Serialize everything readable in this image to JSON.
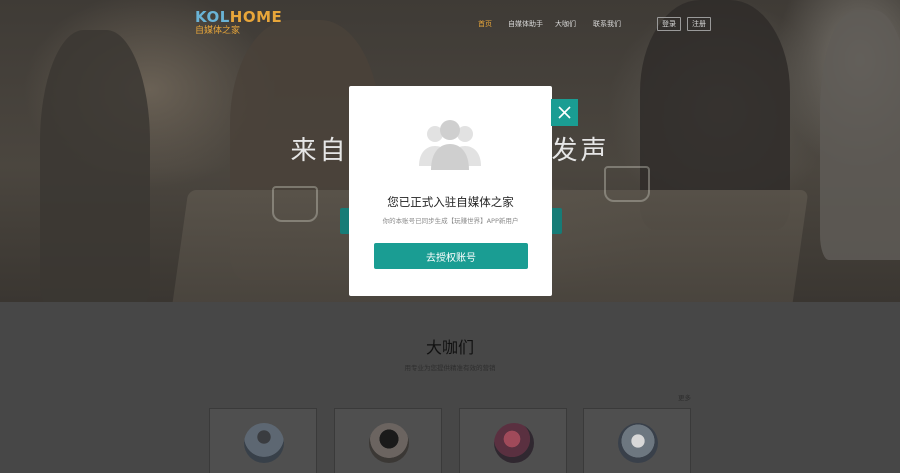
{
  "header": {
    "logo_main_left": "KOL",
    "logo_main_right": "HOME",
    "logo_sub": "自媒体之家",
    "nav": [
      "首页",
      "自媒体助手",
      "大咖们",
      "联系我们"
    ],
    "login": "登录",
    "register": "注册"
  },
  "hero": {
    "title": "来自媒体之家，为你发声"
  },
  "modal": {
    "title": "您已正式入驻自媒体之家",
    "subtitle": "你的本账号已同步生成【玩赚世界】APP新用户",
    "button": "去授权账号",
    "icon": "users-group-icon",
    "close_icon": "close-icon",
    "accent_color": "#1a9d93"
  },
  "section": {
    "title": "大咖们",
    "subtitle": "用专业为您提供精准有效的营销",
    "more": "更多",
    "cards": [
      "avatar-1",
      "avatar-2",
      "avatar-3",
      "avatar-4"
    ]
  }
}
